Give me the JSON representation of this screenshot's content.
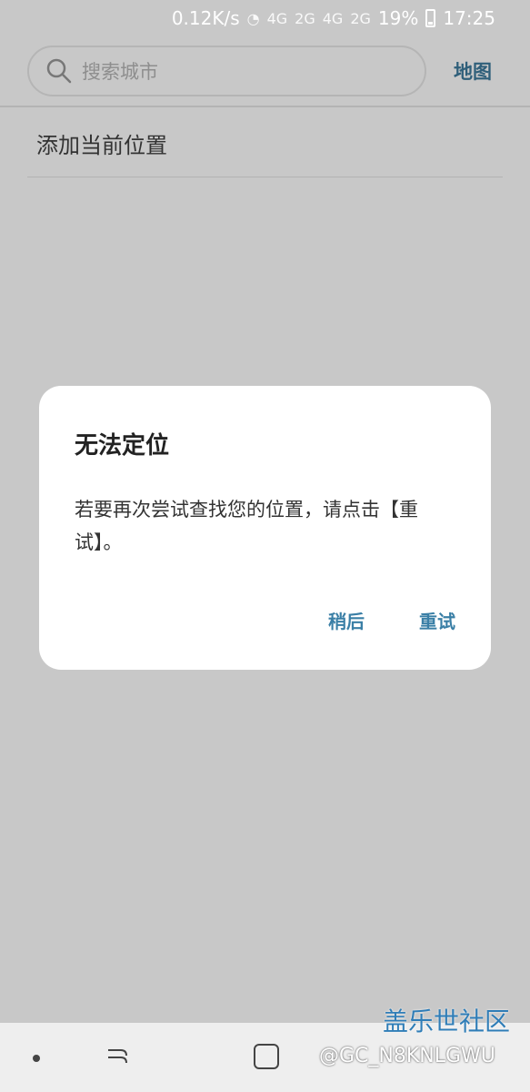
{
  "status_bar": {
    "network_speed": "0.12K/s",
    "network_labels": [
      "4G",
      "2G",
      "4G",
      "2G"
    ],
    "battery": "19%",
    "time": "17:25"
  },
  "search": {
    "placeholder": "搜索城市",
    "map_label": "地图"
  },
  "list": {
    "add_current_location": "添加当前位置"
  },
  "dialog": {
    "title": "无法定位",
    "message": "若要再次尝试查找您的位置，请点击【重试】。",
    "later": "稍后",
    "retry": "重试"
  },
  "watermark": {
    "main": "盖乐世社区",
    "user": "@GC_N8KNLGWU"
  },
  "colors": {
    "background": "#c8c8c8",
    "accent": "#3a7fa6",
    "map": "#2f5f7a",
    "dialog": "#ffffff"
  }
}
